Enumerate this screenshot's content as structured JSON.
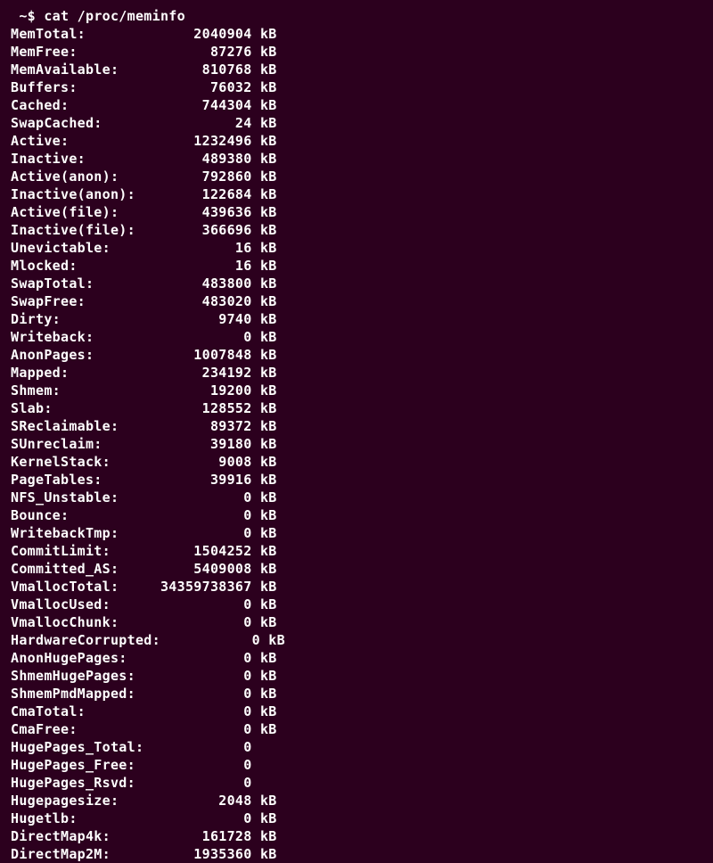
{
  "prompt": " ~$ ",
  "command": "cat /proc/meminfo",
  "label_width": 17,
  "value_width": 12,
  "rows": [
    {
      "label": "MemTotal:",
      "value": "2040904",
      "unit": "kB"
    },
    {
      "label": "MemFree:",
      "value": "87276",
      "unit": "kB"
    },
    {
      "label": "MemAvailable:",
      "value": "810768",
      "unit": "kB"
    },
    {
      "label": "Buffers:",
      "value": "76032",
      "unit": "kB"
    },
    {
      "label": "Cached:",
      "value": "744304",
      "unit": "kB"
    },
    {
      "label": "SwapCached:",
      "value": "24",
      "unit": "kB"
    },
    {
      "label": "Active:",
      "value": "1232496",
      "unit": "kB"
    },
    {
      "label": "Inactive:",
      "value": "489380",
      "unit": "kB"
    },
    {
      "label": "Active(anon):",
      "value": "792860",
      "unit": "kB"
    },
    {
      "label": "Inactive(anon):",
      "value": "122684",
      "unit": "kB"
    },
    {
      "label": "Active(file):",
      "value": "439636",
      "unit": "kB"
    },
    {
      "label": "Inactive(file):",
      "value": "366696",
      "unit": "kB"
    },
    {
      "label": "Unevictable:",
      "value": "16",
      "unit": "kB"
    },
    {
      "label": "Mlocked:",
      "value": "16",
      "unit": "kB"
    },
    {
      "label": "SwapTotal:",
      "value": "483800",
      "unit": "kB"
    },
    {
      "label": "SwapFree:",
      "value": "483020",
      "unit": "kB"
    },
    {
      "label": "Dirty:",
      "value": "9740",
      "unit": "kB"
    },
    {
      "label": "Writeback:",
      "value": "0",
      "unit": "kB"
    },
    {
      "label": "AnonPages:",
      "value": "1007848",
      "unit": "kB"
    },
    {
      "label": "Mapped:",
      "value": "234192",
      "unit": "kB"
    },
    {
      "label": "Shmem:",
      "value": "19200",
      "unit": "kB"
    },
    {
      "label": "Slab:",
      "value": "128552",
      "unit": "kB"
    },
    {
      "label": "SReclaimable:",
      "value": "89372",
      "unit": "kB"
    },
    {
      "label": "SUnreclaim:",
      "value": "39180",
      "unit": "kB"
    },
    {
      "label": "KernelStack:",
      "value": "9008",
      "unit": "kB"
    },
    {
      "label": "PageTables:",
      "value": "39916",
      "unit": "kB"
    },
    {
      "label": "NFS_Unstable:",
      "value": "0",
      "unit": "kB"
    },
    {
      "label": "Bounce:",
      "value": "0",
      "unit": "kB"
    },
    {
      "label": "WritebackTmp:",
      "value": "0",
      "unit": "kB"
    },
    {
      "label": "CommitLimit:",
      "value": "1504252",
      "unit": "kB"
    },
    {
      "label": "Committed_AS:",
      "value": "5409008",
      "unit": "kB"
    },
    {
      "label": "VmallocTotal:",
      "value": "34359738367",
      "unit": "kB"
    },
    {
      "label": "VmallocUsed:",
      "value": "0",
      "unit": "kB"
    },
    {
      "label": "VmallocChunk:",
      "value": "0",
      "unit": "kB"
    },
    {
      "label": "HardwareCorrupted:",
      "value": "0",
      "unit": "kB"
    },
    {
      "label": "AnonHugePages:",
      "value": "0",
      "unit": "kB"
    },
    {
      "label": "ShmemHugePages:",
      "value": "0",
      "unit": "kB"
    },
    {
      "label": "ShmemPmdMapped:",
      "value": "0",
      "unit": "kB"
    },
    {
      "label": "CmaTotal:",
      "value": "0",
      "unit": "kB"
    },
    {
      "label": "CmaFree:",
      "value": "0",
      "unit": "kB"
    },
    {
      "label": "HugePages_Total:",
      "value": "0",
      "unit": ""
    },
    {
      "label": "HugePages_Free:",
      "value": "0",
      "unit": ""
    },
    {
      "label": "HugePages_Rsvd:",
      "value": "0",
      "unit": ""
    },
    {
      "label": "Hugepagesize:",
      "value": "2048",
      "unit": "kB"
    },
    {
      "label": "Hugetlb:",
      "value": "0",
      "unit": "kB"
    },
    {
      "label": "DirectMap4k:",
      "value": "161728",
      "unit": "kB"
    },
    {
      "label": "DirectMap2M:",
      "value": "1935360",
      "unit": "kB"
    }
  ]
}
